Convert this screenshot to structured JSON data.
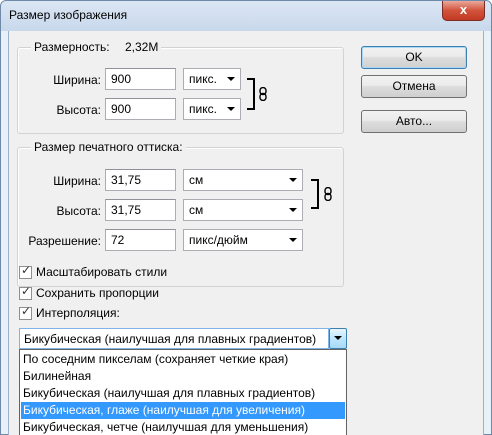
{
  "window": {
    "title": "Размер изображения",
    "close_glyph": "x"
  },
  "dimensions": {
    "label": "Размерность:",
    "size": "2,32M",
    "width": {
      "label": "Ширина:",
      "value": "900",
      "unit": "пикс."
    },
    "height": {
      "label": "Высота:",
      "value": "900",
      "unit": "пикс."
    }
  },
  "print_size": {
    "title": "Размер печатного оттиска:",
    "width": {
      "label": "Ширина:",
      "value": "31,75",
      "unit": "см"
    },
    "height": {
      "label": "Высота:",
      "value": "31,75",
      "unit": "см"
    },
    "resolution": {
      "label": "Разрешение:",
      "value": "72",
      "unit": "пикс/дюйм"
    }
  },
  "buttons": {
    "ok": "OK",
    "cancel": "Отмена",
    "auto": "Авто..."
  },
  "options": {
    "scale_styles": {
      "label": "Масштабировать стили",
      "checked": true
    },
    "constrain": {
      "label": "Сохранить пропорции",
      "checked": true
    },
    "resample": {
      "label": "Интерполяция:",
      "checked": true
    }
  },
  "interpolation": {
    "selected": "Бикубическая (наилучшая для плавных градиентов)",
    "items": [
      "По соседним пикселам (сохраняет четкие края)",
      "Билинейная",
      "Бикубическая (наилучшая для плавных градиентов)",
      "Бикубическая, глаже (наилучшая для увеличения)",
      "Бикубическая, четче (наилучшая для уменьшения)"
    ],
    "highlighted_index": 3
  },
  "icons": {
    "chain": "chain-link-icon",
    "check": "✓"
  },
  "colors": {
    "highlight": "#3399ff",
    "default_button_border": "#3c7fb1"
  }
}
